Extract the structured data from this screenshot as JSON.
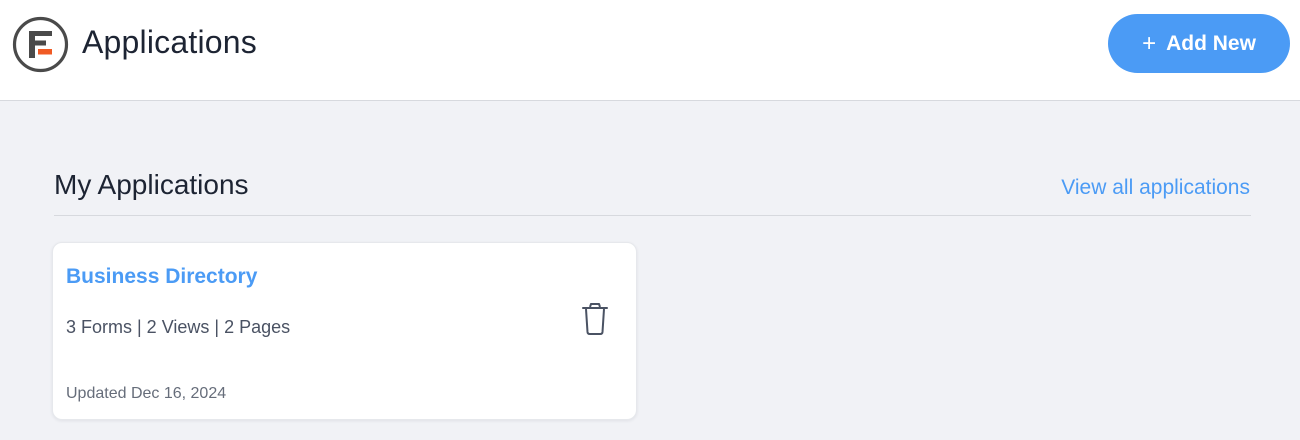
{
  "header": {
    "title": "Applications",
    "logo_icon": "formidable-logo-icon",
    "add_button": {
      "icon": "plus-icon",
      "plus_glyph": "+",
      "label": "Add New"
    }
  },
  "section": {
    "title": "My Applications",
    "view_all_label": "View all applications"
  },
  "applications": [
    {
      "name": "Business Directory",
      "meta": "3 Forms | 2 Views | 2 Pages",
      "updated": "Updated Dec 16, 2024",
      "delete_icon": "trash-icon"
    }
  ],
  "colors": {
    "accent": "#4b9bf5",
    "logo_orange": "#f05a24",
    "logo_dark": "#4a4a4a",
    "background": "#f1f2f6"
  }
}
